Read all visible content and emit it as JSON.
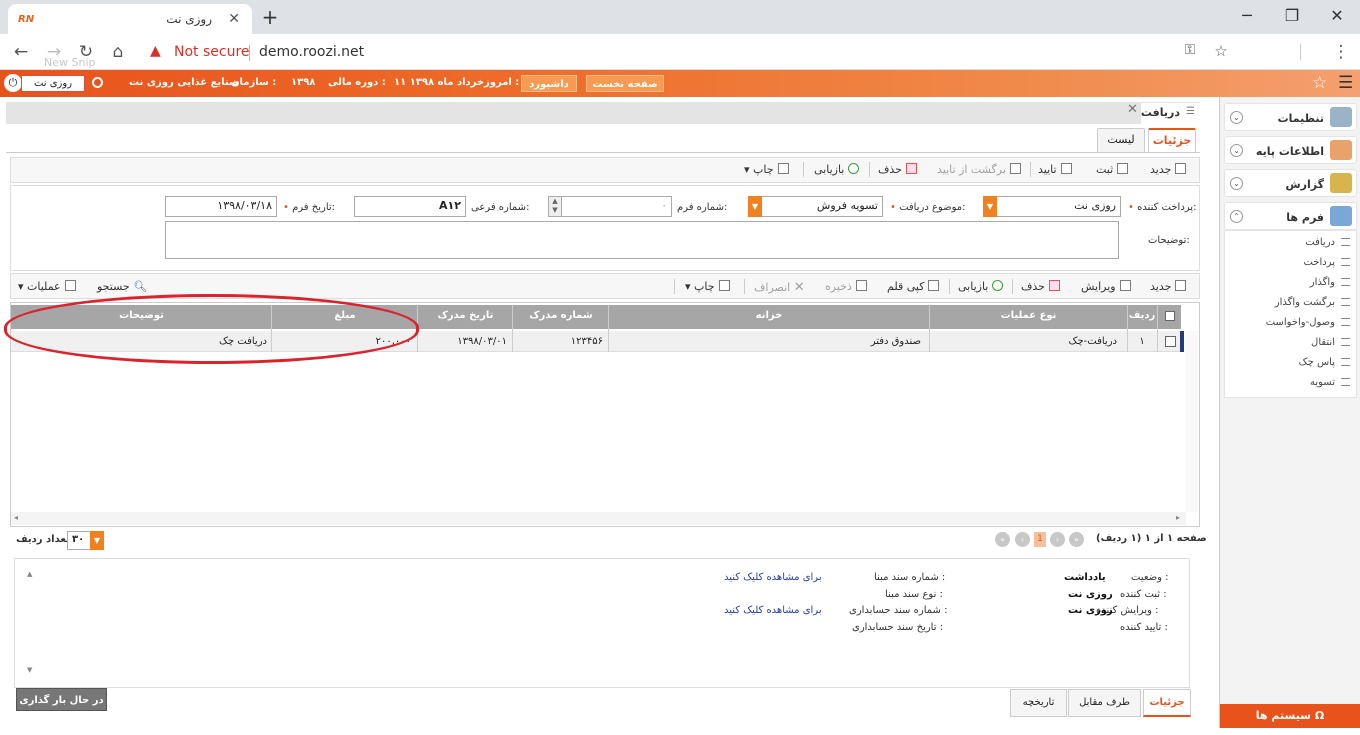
{
  "browser": {
    "tab_title": "روزی نت",
    "favicon": "RN",
    "url": "demo.roozi.net",
    "security": "Not secure",
    "ghost_text": "New Snip"
  },
  "appbar": {
    "user": "روزی نت",
    "org_label": "سازمان :",
    "org_value": "صنایع غذایی روزی نت",
    "year_label": "دوره مالی :",
    "year_value": "۱۳۹۸",
    "today_label": "امروز :",
    "today_value": "۱۱ خرداد ماه ۱۳۹۸",
    "dashboard": "داشبورد",
    "home": "صفحه نخست"
  },
  "sidebar": {
    "settings": "تنظیمات",
    "basic_info": "اطلاعات پایه",
    "report": "گزارش",
    "forms": "فرم ها",
    "items": [
      "دریافت",
      "پرداخت",
      "واگذار",
      "برگشت واگذار",
      "وصول-واخواست",
      "انتقال",
      "پاس چک",
      "تسویه"
    ],
    "system": "سیستم ها"
  },
  "main": {
    "breadcrumb": "دریافت",
    "tab_details": "جزئیات",
    "tab_list": "لیست"
  },
  "toolbar1": {
    "new": "جدید",
    "save": "ثبت",
    "confirm": "تایید",
    "unconfirm": "برگشت از تایید",
    "delete": "حذف",
    "reload": "بازیابی",
    "print": "چاپ"
  },
  "form": {
    "payer_label": "پرداخت کننده:",
    "payer_value": "روزی نت",
    "subject_label": "موضوع دریافت:",
    "subject_value": "تسویه فروش",
    "formno_label": "شماره فرم:",
    "formno_value": "۰",
    "subno_label": "شماره فرعی:",
    "subno_value": "A۱۲",
    "date_label": "تاریخ فرم:",
    "date_value": "۱۳۹۸/۰۳/۱۸",
    "desc_label": "توضیحات:"
  },
  "toolbar2": {
    "new": "جدید",
    "edit": "ویرایش",
    "delete": "حذف",
    "reload": "بازیابی",
    "copy": "کپی قلم",
    "save": "ذخیره",
    "cancel": "انصراف",
    "print": "چاپ",
    "search": "جستجو",
    "ops": "عملیات"
  },
  "grid": {
    "headers": {
      "row": "ردیف",
      "optype": "نوع عملیات",
      "treasury": "خزانه",
      "docno": "شماره مدرک",
      "docdate": "تاریخ مدرک",
      "amount": "مبلغ",
      "desc": "توضیحات"
    },
    "rows": [
      {
        "row": "۱",
        "optype": "دریافت-چک",
        "treasury": "صندوق دفتر",
        "docno": "۱۲۳۴۵۶",
        "docdate": "۱۳۹۸/۰۳/۰۱",
        "amount": "۲۰۰,۰۰۰",
        "desc": "دریافت چک"
      }
    ]
  },
  "pager": {
    "text": "صفحه ۱ از ۱ (۱ ردیف)",
    "current": "1",
    "rows_label": "تعداد ردیف",
    "rows_value": "۳۰"
  },
  "detail": {
    "status_label": "وضعیت :",
    "status_value": "یادداشت",
    "creator_label": "ثبت کننده :",
    "creator_value": "روزی نت",
    "editor_label": "ویرایش کننده :",
    "editor_value": "روزی نت",
    "approver_label": "تایید کننده :",
    "base_no_label": "شماره سند مبنا :",
    "base_type_label": "نوع سند مبنا :",
    "acc_no_label": "شماره سند حسابداری :",
    "acc_date_label": "تاریخ سند حسابداری :",
    "link_text": "برای مشاهده کلیک کنید",
    "tab_details": "جزئیات",
    "tab_party": "طرف مقابل",
    "tab_history": "تاریخچه",
    "loading": "در حال بار گذاری ..."
  },
  "colors": {
    "accent": "#e8531c",
    "highlight": "#d9232d"
  }
}
